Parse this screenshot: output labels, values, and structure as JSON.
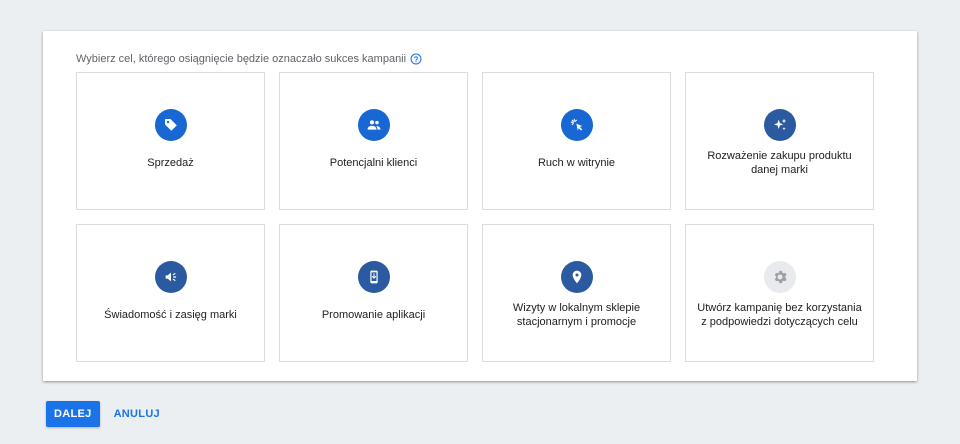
{
  "prompt": {
    "text": "Wybierz cel, którego osiągnięcie będzie oznaczało sukces kampanii",
    "help_icon": "help-circle-icon"
  },
  "goals": [
    {
      "label": "Sprzedaż",
      "icon": "tag-icon"
    },
    {
      "label": "Potencjalni klienci",
      "icon": "people-icon"
    },
    {
      "label": "Ruch w witrynie",
      "icon": "cursor-click-icon"
    },
    {
      "label": "Rozważenie zakupu produktu danej marki",
      "icon": "sparkle-icon"
    },
    {
      "label": "Świadomość i zasięg marki",
      "icon": "megaphone-icon"
    },
    {
      "label": "Promowanie aplikacji",
      "icon": "mobile-download-icon"
    },
    {
      "label": "Wizyty w lokalnym sklepie stacjonarnym i promocje",
      "icon": "location-pin-icon"
    },
    {
      "label": "Utwórz kampanię bez korzystania z podpowiedzi dotyczących celu",
      "icon": "gear-icon"
    }
  ],
  "actions": {
    "next_label": "DALEJ",
    "cancel_label": "ANULUJ"
  },
  "colors": {
    "accent": "#1a73e8",
    "icon_bg": "#1967d2",
    "icon_bg_brand": "#2b5aa0",
    "icon_bg_disabled": "#e8eaed",
    "page_bg": "#eceff1"
  }
}
